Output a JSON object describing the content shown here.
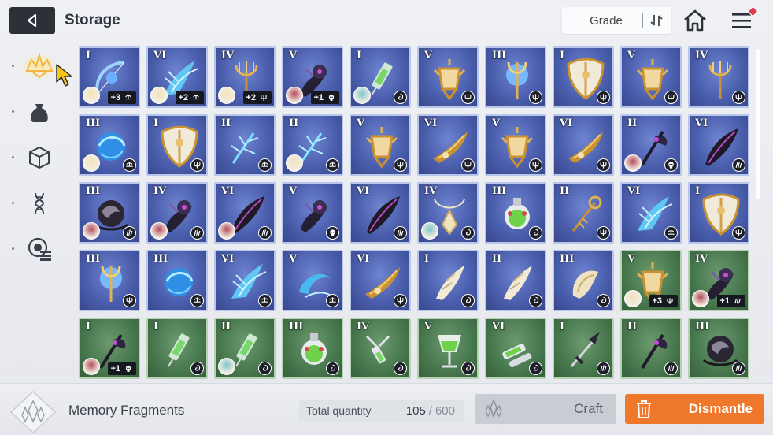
{
  "header": {
    "title": "Storage",
    "grade_label": "Grade"
  },
  "sidebar": {
    "items": [
      {
        "icon": "sparkle-crown-icon",
        "active": true
      },
      {
        "icon": "pouch-icon",
        "active": false
      },
      {
        "icon": "cube-icon",
        "active": false
      },
      {
        "icon": "dna-icon",
        "active": false
      },
      {
        "icon": "module-icon",
        "active": false
      }
    ]
  },
  "grid": {
    "rows": [
      [
        {
          "grade": "I",
          "bg": "blue",
          "art": "bow",
          "chara": "blonde",
          "type": "libra",
          "plus": "+3"
        },
        {
          "grade": "VI",
          "bg": "blue",
          "art": "crystal-wing",
          "chara": "blonde",
          "type": "libra",
          "plus": "+2"
        },
        {
          "grade": "IV",
          "bg": "blue",
          "art": "trident",
          "chara": "blonde",
          "type": "trident",
          "plus": "+2"
        },
        {
          "grade": "V",
          "bg": "blue",
          "art": "dark-claw",
          "chara": "red",
          "type": "skull",
          "plus": "+1"
        },
        {
          "grade": "I",
          "bg": "blue",
          "art": "syringe",
          "chara": "teal",
          "type": "swirl",
          "plus": ""
        },
        {
          "grade": "V",
          "bg": "blue",
          "art": "lantern",
          "chara": "",
          "type": "trident",
          "plus": ""
        },
        {
          "grade": "III",
          "bg": "blue",
          "art": "orb-trident",
          "chara": "",
          "type": "trident",
          "plus": ""
        },
        {
          "grade": "I",
          "bg": "blue",
          "art": "shield",
          "chara": "",
          "type": "trident",
          "plus": ""
        },
        {
          "grade": "V",
          "bg": "blue",
          "art": "lantern",
          "chara": "",
          "type": "trident",
          "plus": ""
        },
        {
          "grade": "IV",
          "bg": "blue",
          "art": "trident",
          "chara": "",
          "type": "trident",
          "plus": ""
        }
      ],
      [
        {
          "grade": "III",
          "bg": "blue",
          "art": "blue-orb",
          "chara": "blonde",
          "type": "libra",
          "plus": ""
        },
        {
          "grade": "I",
          "bg": "blue",
          "art": "shield",
          "chara": "",
          "type": "trident",
          "plus": ""
        },
        {
          "grade": "II",
          "bg": "blue",
          "art": "crystal-branch",
          "chara": "",
          "type": "libra",
          "plus": ""
        },
        {
          "grade": "II",
          "bg": "blue",
          "art": "crystal-branch",
          "chara": "blonde",
          "type": "libra",
          "plus": ""
        },
        {
          "grade": "V",
          "bg": "blue",
          "art": "lantern",
          "chara": "",
          "type": "trident",
          "plus": ""
        },
        {
          "grade": "VI",
          "bg": "blue",
          "art": "gold-wing",
          "chara": "",
          "type": "trident",
          "plus": ""
        },
        {
          "grade": "V",
          "bg": "blue",
          "art": "lantern",
          "chara": "",
          "type": "trident",
          "plus": ""
        },
        {
          "grade": "VI",
          "bg": "blue",
          "art": "gold-wing",
          "chara": "",
          "type": "trident",
          "plus": ""
        },
        {
          "grade": "II",
          "bg": "blue",
          "art": "dark-axe",
          "chara": "red",
          "type": "skull",
          "plus": ""
        },
        {
          "grade": "VI",
          "bg": "blue",
          "art": "dark-feather",
          "chara": "",
          "type": "claw",
          "plus": ""
        }
      ],
      [
        {
          "grade": "III",
          "bg": "blue",
          "art": "dark-orb",
          "chara": "red",
          "type": "claw",
          "plus": ""
        },
        {
          "grade": "IV",
          "bg": "blue",
          "art": "dark-claw",
          "chara": "red",
          "type": "claw",
          "plus": ""
        },
        {
          "grade": "VI",
          "bg": "blue",
          "art": "dark-feather",
          "chara": "red",
          "type": "claw",
          "plus": ""
        },
        {
          "grade": "V",
          "bg": "blue",
          "art": "dark-claw",
          "chara": "",
          "type": "skull",
          "plus": ""
        },
        {
          "grade": "VI",
          "bg": "blue",
          "art": "dark-feather",
          "chara": "",
          "type": "claw",
          "plus": ""
        },
        {
          "grade": "IV",
          "bg": "blue",
          "art": "pendant",
          "chara": "teal",
          "type": "swirl",
          "plus": ""
        },
        {
          "grade": "III",
          "bg": "blue",
          "art": "green-flask",
          "chara": "",
          "type": "swirl",
          "plus": ""
        },
        {
          "grade": "II",
          "bg": "blue",
          "art": "scepter",
          "chara": "",
          "type": "trident",
          "plus": ""
        },
        {
          "grade": "VI",
          "bg": "blue",
          "art": "crystal-wing",
          "chara": "",
          "type": "libra",
          "plus": ""
        },
        {
          "grade": "I",
          "bg": "blue",
          "art": "shield",
          "chara": "",
          "type": "trident",
          "plus": ""
        }
      ],
      [
        {
          "grade": "III",
          "bg": "blue",
          "art": "orb-trident",
          "chara": "",
          "type": "trident",
          "plus": ""
        },
        {
          "grade": "III",
          "bg": "blue",
          "art": "blue-orb",
          "chara": "",
          "type": "libra",
          "plus": ""
        },
        {
          "grade": "VI",
          "bg": "blue",
          "art": "crystal-wing",
          "chara": "",
          "type": "libra",
          "plus": ""
        },
        {
          "grade": "V",
          "bg": "blue",
          "art": "crystal-swirl",
          "chara": "",
          "type": "libra",
          "plus": ""
        },
        {
          "grade": "VI",
          "bg": "blue",
          "art": "gold-wing",
          "chara": "",
          "type": "trident",
          "plus": ""
        },
        {
          "grade": "I",
          "bg": "blue",
          "art": "pale-flower",
          "chara": "",
          "type": "swirl",
          "plus": ""
        },
        {
          "grade": "II",
          "bg": "blue",
          "art": "pale-flower",
          "chara": "",
          "type": "swirl",
          "plus": ""
        },
        {
          "grade": "III",
          "bg": "blue",
          "art": "pale-shell",
          "chara": "",
          "type": "swirl",
          "plus": ""
        },
        {
          "grade": "V",
          "bg": "green",
          "art": "lantern",
          "chara": "blonde",
          "type": "trident",
          "plus": "+3"
        },
        {
          "grade": "IV",
          "bg": "green",
          "art": "dark-claw",
          "chara": "red",
          "type": "claw",
          "plus": "+1"
        }
      ],
      [
        {
          "grade": "I",
          "bg": "green",
          "art": "dark-axe",
          "chara": "red",
          "type": "skull",
          "plus": "+1"
        },
        {
          "grade": "I",
          "bg": "green",
          "art": "syringe",
          "chara": "",
          "type": "swirl",
          "plus": ""
        },
        {
          "grade": "II",
          "bg": "green",
          "art": "syringe",
          "chara": "teal",
          "type": "swirl",
          "plus": ""
        },
        {
          "grade": "III",
          "bg": "green",
          "art": "green-flask",
          "chara": "",
          "type": "swirl",
          "plus": ""
        },
        {
          "grade": "IV",
          "bg": "green",
          "art": "chain-vial",
          "chara": "",
          "type": "swirl",
          "plus": ""
        },
        {
          "grade": "V",
          "bg": "green",
          "art": "goblet",
          "chara": "",
          "type": "swirl",
          "plus": ""
        },
        {
          "grade": "VI",
          "bg": "green",
          "art": "vials",
          "chara": "",
          "type": "swirl",
          "plus": ""
        },
        {
          "grade": "I",
          "bg": "green",
          "art": "dark-dagger",
          "chara": "",
          "type": "claw",
          "plus": ""
        },
        {
          "grade": "II",
          "bg": "green",
          "art": "dark-axe",
          "chara": "",
          "type": "claw",
          "plus": ""
        },
        {
          "grade": "III",
          "bg": "green",
          "art": "dark-orb",
          "chara": "",
          "type": "claw",
          "plus": ""
        }
      ]
    ]
  },
  "footer": {
    "resource_label": "Memory Fragments",
    "qty_label": "Total quantity",
    "qty_current": "105",
    "qty_slash": "/",
    "qty_max": "600",
    "craft_label": "Craft",
    "dismantle_label": "Dismantle"
  },
  "colors": {
    "accent": "#f0782b",
    "tile_blue": "#4b5fae",
    "tile_green": "#4a7a50",
    "back_button": "#2e3038"
  }
}
